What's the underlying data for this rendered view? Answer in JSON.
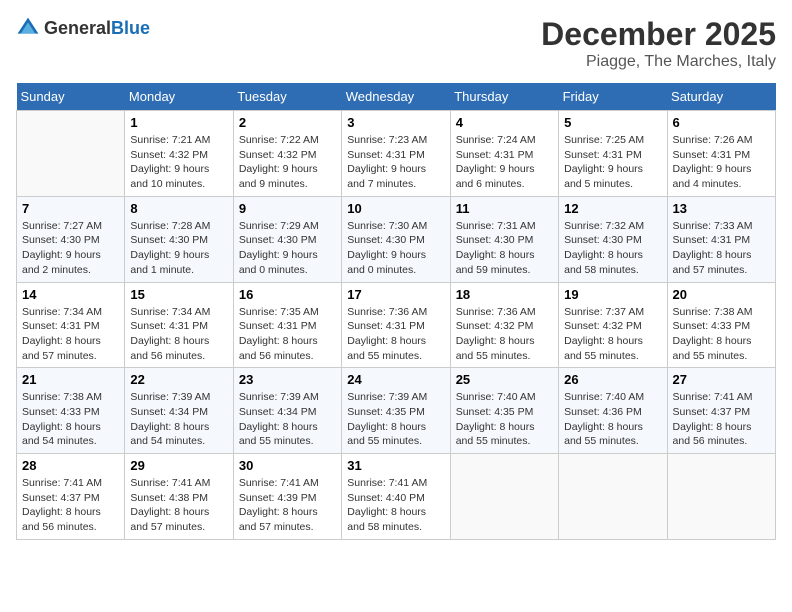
{
  "header": {
    "logo_general": "General",
    "logo_blue": "Blue",
    "month_title": "December 2025",
    "location": "Piagge, The Marches, Italy"
  },
  "days_of_week": [
    "Sunday",
    "Monday",
    "Tuesday",
    "Wednesday",
    "Thursday",
    "Friday",
    "Saturday"
  ],
  "weeks": [
    [
      {
        "day": "",
        "info": ""
      },
      {
        "day": "1",
        "info": "Sunrise: 7:21 AM\nSunset: 4:32 PM\nDaylight: 9 hours\nand 10 minutes."
      },
      {
        "day": "2",
        "info": "Sunrise: 7:22 AM\nSunset: 4:32 PM\nDaylight: 9 hours\nand 9 minutes."
      },
      {
        "day": "3",
        "info": "Sunrise: 7:23 AM\nSunset: 4:31 PM\nDaylight: 9 hours\nand 7 minutes."
      },
      {
        "day": "4",
        "info": "Sunrise: 7:24 AM\nSunset: 4:31 PM\nDaylight: 9 hours\nand 6 minutes."
      },
      {
        "day": "5",
        "info": "Sunrise: 7:25 AM\nSunset: 4:31 PM\nDaylight: 9 hours\nand 5 minutes."
      },
      {
        "day": "6",
        "info": "Sunrise: 7:26 AM\nSunset: 4:31 PM\nDaylight: 9 hours\nand 4 minutes."
      }
    ],
    [
      {
        "day": "7",
        "info": "Sunrise: 7:27 AM\nSunset: 4:30 PM\nDaylight: 9 hours\nand 2 minutes."
      },
      {
        "day": "8",
        "info": "Sunrise: 7:28 AM\nSunset: 4:30 PM\nDaylight: 9 hours\nand 1 minute."
      },
      {
        "day": "9",
        "info": "Sunrise: 7:29 AM\nSunset: 4:30 PM\nDaylight: 9 hours\nand 0 minutes."
      },
      {
        "day": "10",
        "info": "Sunrise: 7:30 AM\nSunset: 4:30 PM\nDaylight: 9 hours\nand 0 minutes."
      },
      {
        "day": "11",
        "info": "Sunrise: 7:31 AM\nSunset: 4:30 PM\nDaylight: 8 hours\nand 59 minutes."
      },
      {
        "day": "12",
        "info": "Sunrise: 7:32 AM\nSunset: 4:30 PM\nDaylight: 8 hours\nand 58 minutes."
      },
      {
        "day": "13",
        "info": "Sunrise: 7:33 AM\nSunset: 4:31 PM\nDaylight: 8 hours\nand 57 minutes."
      }
    ],
    [
      {
        "day": "14",
        "info": "Sunrise: 7:34 AM\nSunset: 4:31 PM\nDaylight: 8 hours\nand 57 minutes."
      },
      {
        "day": "15",
        "info": "Sunrise: 7:34 AM\nSunset: 4:31 PM\nDaylight: 8 hours\nand 56 minutes."
      },
      {
        "day": "16",
        "info": "Sunrise: 7:35 AM\nSunset: 4:31 PM\nDaylight: 8 hours\nand 56 minutes."
      },
      {
        "day": "17",
        "info": "Sunrise: 7:36 AM\nSunset: 4:31 PM\nDaylight: 8 hours\nand 55 minutes."
      },
      {
        "day": "18",
        "info": "Sunrise: 7:36 AM\nSunset: 4:32 PM\nDaylight: 8 hours\nand 55 minutes."
      },
      {
        "day": "19",
        "info": "Sunrise: 7:37 AM\nSunset: 4:32 PM\nDaylight: 8 hours\nand 55 minutes."
      },
      {
        "day": "20",
        "info": "Sunrise: 7:38 AM\nSunset: 4:33 PM\nDaylight: 8 hours\nand 55 minutes."
      }
    ],
    [
      {
        "day": "21",
        "info": "Sunrise: 7:38 AM\nSunset: 4:33 PM\nDaylight: 8 hours\nand 54 minutes."
      },
      {
        "day": "22",
        "info": "Sunrise: 7:39 AM\nSunset: 4:34 PM\nDaylight: 8 hours\nand 54 minutes."
      },
      {
        "day": "23",
        "info": "Sunrise: 7:39 AM\nSunset: 4:34 PM\nDaylight: 8 hours\nand 55 minutes."
      },
      {
        "day": "24",
        "info": "Sunrise: 7:39 AM\nSunset: 4:35 PM\nDaylight: 8 hours\nand 55 minutes."
      },
      {
        "day": "25",
        "info": "Sunrise: 7:40 AM\nSunset: 4:35 PM\nDaylight: 8 hours\nand 55 minutes."
      },
      {
        "day": "26",
        "info": "Sunrise: 7:40 AM\nSunset: 4:36 PM\nDaylight: 8 hours\nand 55 minutes."
      },
      {
        "day": "27",
        "info": "Sunrise: 7:41 AM\nSunset: 4:37 PM\nDaylight: 8 hours\nand 56 minutes."
      }
    ],
    [
      {
        "day": "28",
        "info": "Sunrise: 7:41 AM\nSunset: 4:37 PM\nDaylight: 8 hours\nand 56 minutes."
      },
      {
        "day": "29",
        "info": "Sunrise: 7:41 AM\nSunset: 4:38 PM\nDaylight: 8 hours\nand 57 minutes."
      },
      {
        "day": "30",
        "info": "Sunrise: 7:41 AM\nSunset: 4:39 PM\nDaylight: 8 hours\nand 57 minutes."
      },
      {
        "day": "31",
        "info": "Sunrise: 7:41 AM\nSunset: 4:40 PM\nDaylight: 8 hours\nand 58 minutes."
      },
      {
        "day": "",
        "info": ""
      },
      {
        "day": "",
        "info": ""
      },
      {
        "day": "",
        "info": ""
      }
    ]
  ]
}
